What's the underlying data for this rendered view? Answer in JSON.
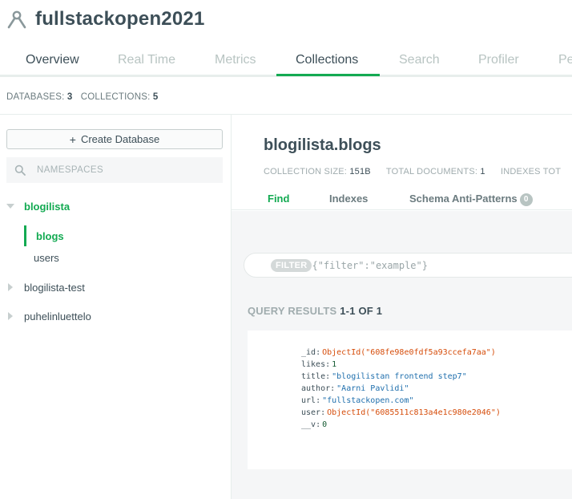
{
  "header": {
    "cluster_name": "fullstackopen2021"
  },
  "tabs": [
    "Overview",
    "Real Time",
    "Metrics",
    "Collections",
    "Search",
    "Profiler",
    "Pe"
  ],
  "db_counts": {
    "databases_label": "DATABASES:",
    "databases_value": "3",
    "collections_label": "COLLECTIONS:",
    "collections_value": "5"
  },
  "sidebar": {
    "create_db_label": "Create Database",
    "create_db_plus": "+",
    "search_placeholder": "NAMESPACES",
    "databases": [
      {
        "name": "blogilista",
        "expanded": true,
        "collections": [
          "blogs",
          "users"
        ]
      },
      {
        "name": "blogilista-test",
        "expanded": false
      },
      {
        "name": "puhelinluettelo",
        "expanded": false
      }
    ]
  },
  "main": {
    "namespace": "blogilista.blogs",
    "stats": {
      "size_label": "COLLECTION SIZE:",
      "size_value": "151B",
      "docs_label": "TOTAL DOCUMENTS:",
      "docs_value": "1",
      "indexes_label": "INDEXES TOT"
    },
    "subtabs": {
      "find": "Find",
      "indexes": "Indexes",
      "schema": "Schema Anti-Patterns",
      "schema_count": "0"
    },
    "filter": {
      "label": "FILTER",
      "placeholder": "{\"filter\":\"example\"}"
    },
    "results": {
      "label": "QUERY RESULTS",
      "range": "1-1 OF 1"
    },
    "document": [
      {
        "key": "_id",
        "value": "ObjectId(\"608fe98e0fdf5a93ccefa7aa\")",
        "type": "oid"
      },
      {
        "key": "likes",
        "value": "1",
        "type": "num"
      },
      {
        "key": "title",
        "value": "\"blogilistan frontend step7\"",
        "type": "str"
      },
      {
        "key": "author",
        "value": "\"Aarni Pavlidi\"",
        "type": "str"
      },
      {
        "key": "url",
        "value": "\"fullstackopen.com\"",
        "type": "str"
      },
      {
        "key": "user",
        "value": "ObjectId(\"6085511c813a4e1c980e2046\")",
        "type": "oid"
      },
      {
        "key": "__v",
        "value": "0",
        "type": "num"
      }
    ]
  },
  "colors": {
    "accent": "#13aa52",
    "text": "#3d4f58",
    "muted": "#b8c4c2",
    "oid": "#d64d0b",
    "string": "#1f6fad"
  }
}
